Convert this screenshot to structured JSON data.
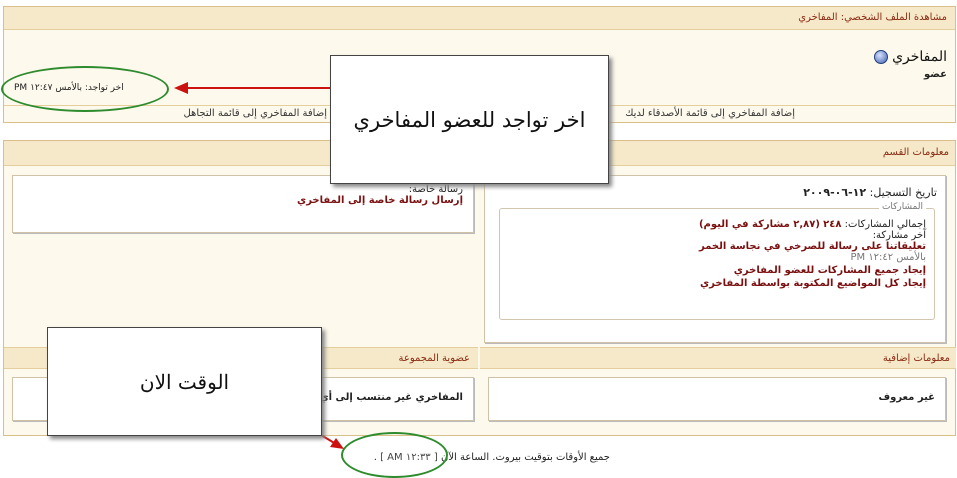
{
  "profile": {
    "header_title": "مشاهدة الملف الشخصي: المفاخري",
    "username": "المفاخري",
    "user_rank": "عضو",
    "last_activity": "اخر تواجد: بالأمس ١٢:٤٧ PM",
    "add_buddy": "إضافة المفاخري إلى قائمة الأصدقاء لديك",
    "add_ignore": "إضافة المفاخري إلى قائمة التجاهل",
    "online_status_icon": "status-dot-icon"
  },
  "forum_info": {
    "header": "معلومات القسم",
    "join_date_label": "تاريخ التسجيل:",
    "join_date_value": "١٢-٠٦-٢٠٠٩",
    "posts_legend": "المشاركات",
    "total_posts_label": "إجمالي المشاركات:",
    "total_posts_value": "٢٤٨",
    "posts_per_day": "(٢,٨٧ مشاركة في اليوم)",
    "last_post_label": "آخر مشاركة:",
    "last_post_title": "تعليقاتنا على رسالة للصرخي في نجاسة الخمر",
    "last_post_time": "بالأمس ١٢:٤٢ PM",
    "find_posts": "إيجاد جميع المشاركات للعضو المفاخري",
    "find_threads": "إيجاد كل المواضيع المكتوبة بواسطة المفاخري"
  },
  "contact": {
    "pm_label": "رسالة خاصة:",
    "pm_link": "إرسال رسالة خاصة إلى المفاخري"
  },
  "additional": {
    "header": "معلومات إضافية",
    "value": "غير معروف"
  },
  "groups": {
    "header": "عضوية المجموعة",
    "text": "المفاخري غير منتسب إلى أي"
  },
  "footer": {
    "timezone_text": "جميع الأوقات بتوقيت بيروت. الساعة الآن",
    "current_time": "[ ١٢:٣٣ AM ]",
    "trailing": "."
  },
  "annotations": {
    "last_seen_callout": "اخر تواجد للعضو المفاخري",
    "now_callout": "الوقت الان"
  },
  "colors": {
    "header_bg": "#f6e9c9",
    "accent_link": "#7a1010",
    "highlight_ellipse": "#2e8b2e",
    "arrow": "#cc1111"
  }
}
